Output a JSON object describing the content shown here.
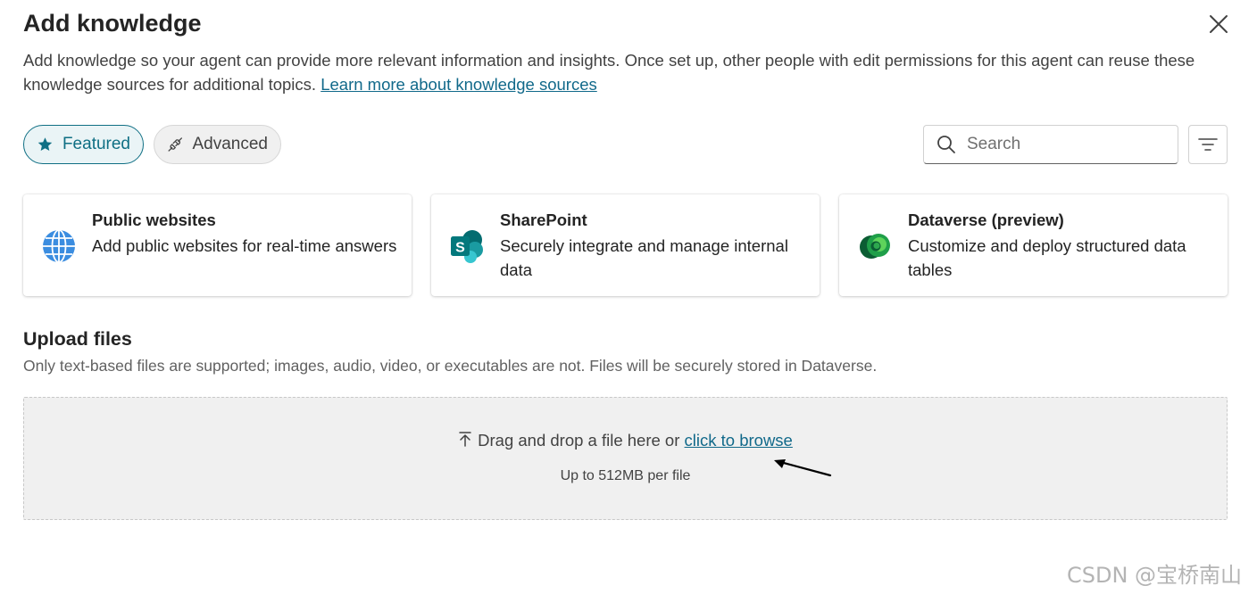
{
  "dialog": {
    "title": "Add knowledge",
    "intro_text": "Add knowledge so your agent can provide more relevant information and insights. Once set up, other people with edit permissions for this agent can reuse these knowledge sources for additional topics.",
    "learn_more_link": "Learn more about knowledge sources",
    "close_icon": "close-icon"
  },
  "tabs": [
    {
      "label": "Featured",
      "icon": "star-icon",
      "selected": true
    },
    {
      "label": "Advanced",
      "icon": "plug-icon",
      "selected": false
    }
  ],
  "search": {
    "placeholder": "Search",
    "value": "",
    "icon": "search-icon"
  },
  "filter": {
    "icon": "filter-icon"
  },
  "sources": [
    {
      "title": "Public websites",
      "description": "Add public websites for real-time answers",
      "icon": "globe-icon"
    },
    {
      "title": "SharePoint",
      "description": "Securely integrate and manage internal data",
      "icon": "sharepoint-icon"
    },
    {
      "title": "Dataverse (preview)",
      "description": "Customize and deploy structured data tables",
      "icon": "dataverse-icon"
    }
  ],
  "upload": {
    "title": "Upload files",
    "description": "Only text-based files are supported; images, audio, video, or executables are not. Files will be securely stored in Dataverse.",
    "drop_text": "Drag and drop a file here or",
    "browse_link": "click to browse",
    "limit_text": "Up to 512MB per file",
    "icon": "upload-icon"
  },
  "watermark": "CSDN @宝桥南山",
  "colors": {
    "accent": "#0f6f84",
    "link": "#11698a"
  }
}
